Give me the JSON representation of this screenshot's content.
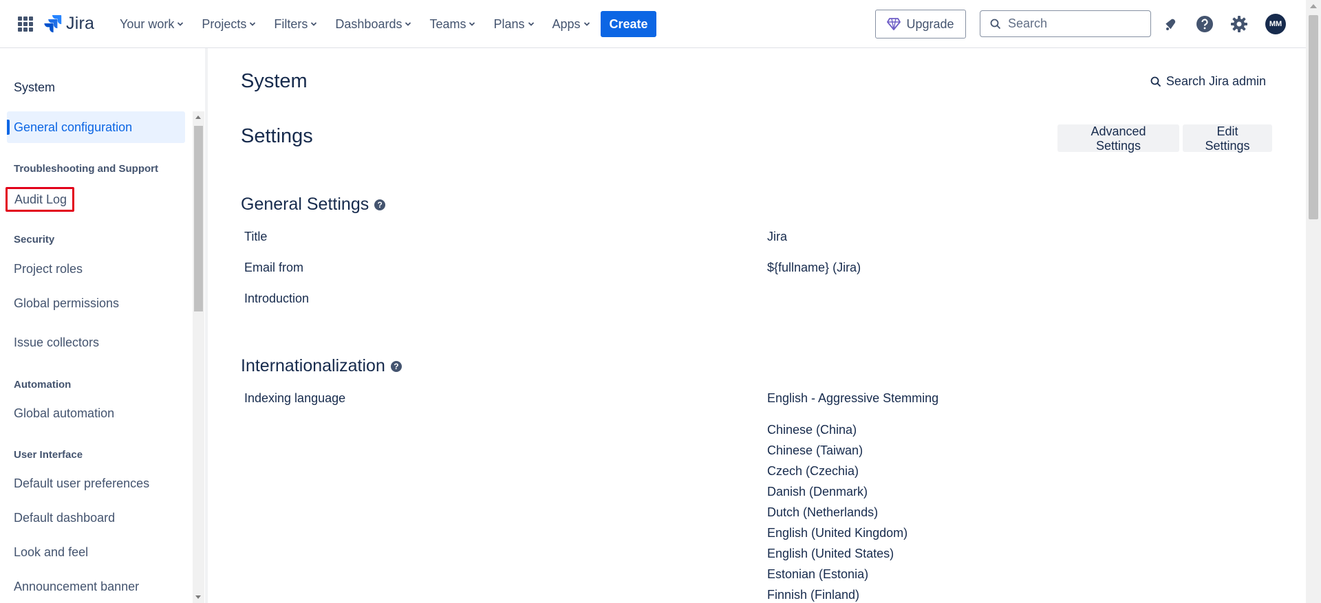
{
  "header": {
    "logo_text": "Jira",
    "nav": [
      "Your work",
      "Projects",
      "Filters",
      "Dashboards",
      "Teams",
      "Plans",
      "Apps"
    ],
    "create_label": "Create",
    "upgrade_label": "Upgrade",
    "search_placeholder": "Search",
    "avatar_initials": "MM"
  },
  "sidebar": {
    "title": "System",
    "items": [
      {
        "label": "General configuration"
      },
      {
        "label": "Audit Log"
      },
      {
        "label": "Project roles"
      },
      {
        "label": "Global permissions"
      },
      {
        "label": "Issue collectors"
      },
      {
        "label": "Global automation"
      },
      {
        "label": "Default user preferences"
      },
      {
        "label": "Default dashboard"
      },
      {
        "label": "Look and feel"
      },
      {
        "label": "Announcement banner"
      }
    ],
    "sections": [
      "Troubleshooting and Support",
      "Security",
      "Automation",
      "User Interface"
    ]
  },
  "main": {
    "title": "System",
    "search_admin": "Search Jira admin",
    "settings_title": "Settings",
    "advanced_settings": "Advanced Settings",
    "edit_settings": "Edit Settings",
    "general_settings": {
      "heading": "General Settings",
      "rows": [
        {
          "label": "Title",
          "value": "Jira"
        },
        {
          "label": "Email from",
          "value": "${fullname} (Jira)"
        },
        {
          "label": "Introduction",
          "value": ""
        }
      ]
    },
    "internationalization": {
      "heading": "Internationalization",
      "indexing_label": "Indexing language",
      "indexing_value": "English - Aggressive Stemming",
      "languages": [
        "Chinese (China)",
        "Chinese (Taiwan)",
        "Czech (Czechia)",
        "Danish (Denmark)",
        "Dutch (Netherlands)",
        "English (United Kingdom)",
        "English (United States)",
        "Estonian (Estonia)",
        "Finnish (Finland)"
      ]
    }
  },
  "colors": {
    "primary": "#0c66e4",
    "text": "#172b4d",
    "subtle_text": "#44546f",
    "highlight_border": "#e2001a"
  }
}
